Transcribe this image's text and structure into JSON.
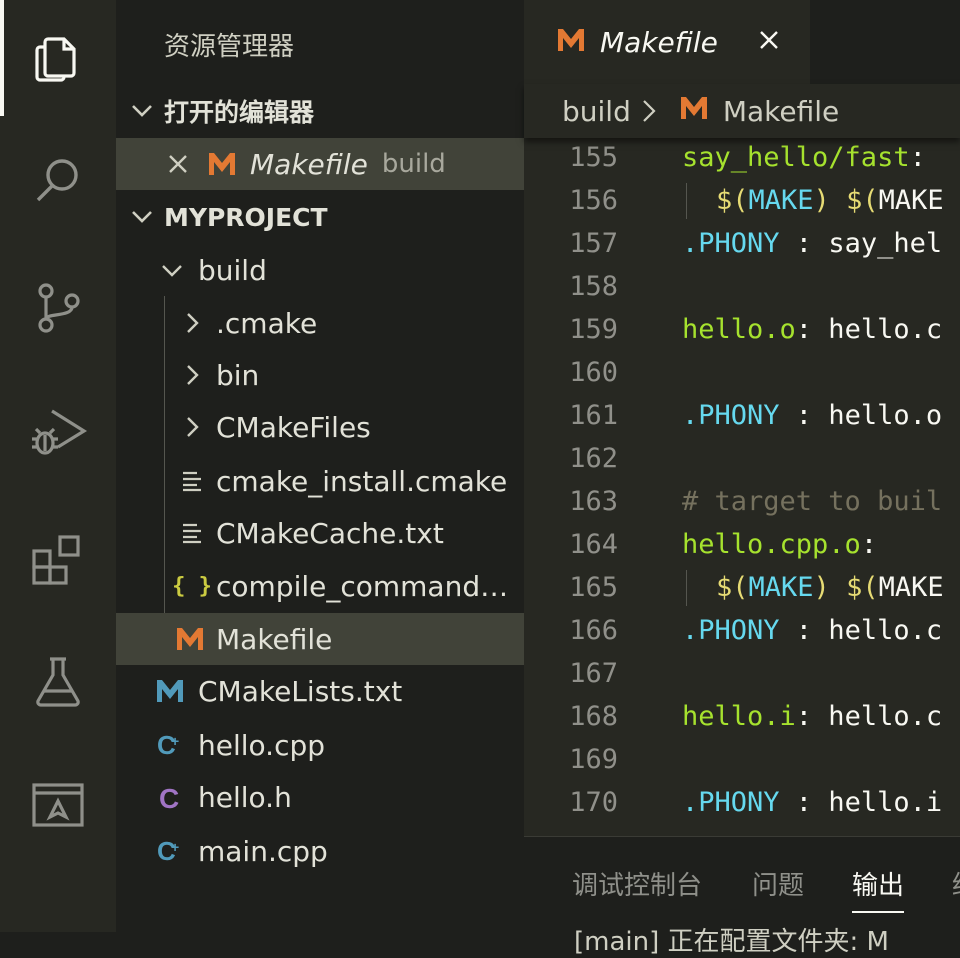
{
  "colors": {
    "accent_m": "#e37933",
    "c_purple": "#a074c4",
    "cpp_blue": "#519aba",
    "json_yellow": "#cbcb41"
  },
  "activity": {
    "items": [
      "files-icon",
      "search-icon",
      "source-control-icon",
      "run-debug-icon",
      "extensions-icon",
      "testing-icon",
      "remote-explorer-icon"
    ]
  },
  "sidebar": {
    "title": "资源管理器",
    "open_editors": {
      "heading": "打开的编辑器",
      "items": [
        {
          "name": "Makefile",
          "hint": "build"
        }
      ]
    },
    "project": {
      "heading": "MYPROJECT",
      "tree": [
        {
          "label": "build",
          "icon": "chevron-down"
        },
        {
          "label": ".cmake",
          "icon": "chevron-right"
        },
        {
          "label": "bin",
          "icon": "chevron-right"
        },
        {
          "label": "CMakeFiles",
          "icon": "chevron-right"
        },
        {
          "label": "cmake_install.cmake",
          "icon": "lines"
        },
        {
          "label": "CMakeCache.txt",
          "icon": "lines"
        },
        {
          "label": "compile_commands.j...",
          "icon": "json"
        },
        {
          "label": "Makefile",
          "icon": "makefile"
        },
        {
          "label": "CMakeLists.txt",
          "icon": "cmake"
        },
        {
          "label": "hello.cpp",
          "icon": "cpp"
        },
        {
          "label": "hello.h",
          "icon": "c"
        },
        {
          "label": "main.cpp",
          "icon": "cpp"
        }
      ]
    }
  },
  "editor": {
    "tab": {
      "title": "Makefile"
    },
    "breadcrumb": {
      "folder": "build",
      "file": "Makefile"
    },
    "lines": [
      {
        "num": "155",
        "parts": [
          [
            "t",
            "say_hello/fast"
          ],
          [
            "p",
            ":"
          ]
        ]
      },
      {
        "num": "156",
        "parts": [
          [
            "s",
            "$("
          ],
          [
            "k",
            "MAKE"
          ],
          [
            "s",
            ")"
          ],
          [
            "p",
            " "
          ],
          [
            "s",
            "$("
          ],
          [
            "p",
            "MAKE"
          ]
        ],
        "indent": true
      },
      {
        "num": "157",
        "parts": [
          [
            "k",
            ".PHONY"
          ],
          [
            "p",
            " : say_hel"
          ]
        ]
      },
      {
        "num": "158",
        "parts": []
      },
      {
        "num": "159",
        "parts": [
          [
            "t",
            "hello.o"
          ],
          [
            "p",
            ": hello.c"
          ]
        ]
      },
      {
        "num": "160",
        "parts": []
      },
      {
        "num": "161",
        "parts": [
          [
            "k",
            ".PHONY"
          ],
          [
            "p",
            " : hello.o"
          ]
        ]
      },
      {
        "num": "162",
        "parts": []
      },
      {
        "num": "163",
        "parts": [
          [
            "c",
            "# target to buil"
          ]
        ]
      },
      {
        "num": "164",
        "parts": [
          [
            "t",
            "hello.cpp.o"
          ],
          [
            "p",
            ":"
          ]
        ]
      },
      {
        "num": "165",
        "parts": [
          [
            "s",
            "$("
          ],
          [
            "k",
            "MAKE"
          ],
          [
            "s",
            ")"
          ],
          [
            "p",
            " "
          ],
          [
            "s",
            "$("
          ],
          [
            "p",
            "MAKE"
          ]
        ],
        "indent": true
      },
      {
        "num": "166",
        "parts": [
          [
            "k",
            ".PHONY"
          ],
          [
            "p",
            " : hello.c"
          ]
        ]
      },
      {
        "num": "167",
        "parts": []
      },
      {
        "num": "168",
        "parts": [
          [
            "t",
            "hello.i"
          ],
          [
            "p",
            ": hello.c"
          ]
        ]
      },
      {
        "num": "169",
        "parts": []
      },
      {
        "num": "170",
        "parts": [
          [
            "k",
            ".PHONY"
          ],
          [
            "p",
            " : hello.i"
          ]
        ]
      }
    ]
  },
  "panel": {
    "tabs": [
      "调试控制台",
      "问题",
      "输出",
      "终"
    ],
    "active_tab": "输出",
    "output_text": "[main] 正在配置文件夹: M"
  }
}
